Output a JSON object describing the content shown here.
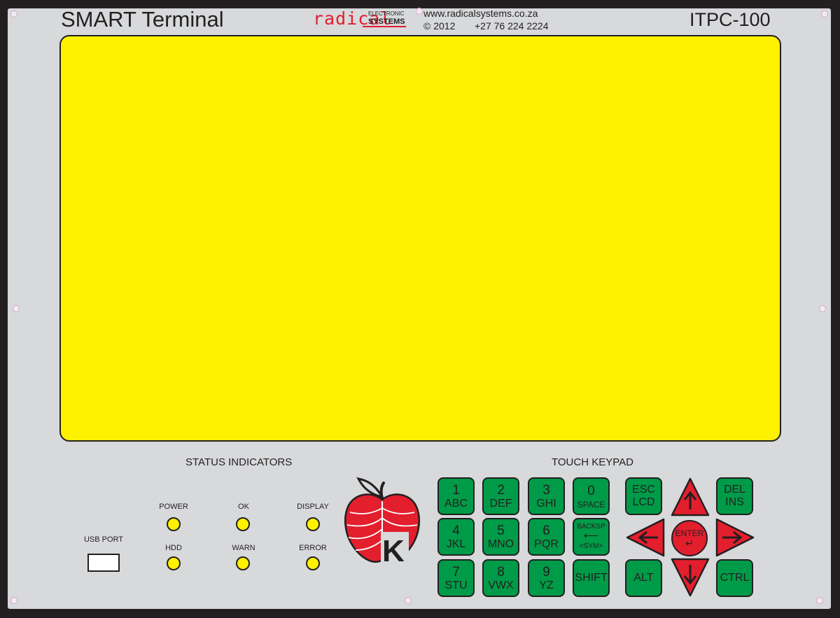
{
  "header": {
    "title": "SMART Terminal",
    "model": "ITPC-100",
    "logo": {
      "word": "radical",
      "sub1": "ELECTRONIC",
      "sub2": "SYSTEMS"
    },
    "website": "www.radicalsystems.co.za",
    "copyright": "© 2012",
    "phone": "+27 76 224 2224"
  },
  "status": {
    "heading": "STATUS INDICATORS",
    "leds": [
      {
        "label": "POWER",
        "color": "#fff200"
      },
      {
        "label": "OK",
        "color": "#fff200"
      },
      {
        "label": "DISPLAY",
        "color": "#fff200"
      },
      {
        "label": "HDD",
        "color": "#fff200"
      },
      {
        "label": "WARN",
        "color": "#fff200"
      },
      {
        "label": "ERROR",
        "color": "#fff200"
      }
    ]
  },
  "usb": {
    "label": "USB PORT"
  },
  "emblem": {
    "letter": "K"
  },
  "keypad": {
    "heading": "TOUCH KEYPAD",
    "keys": {
      "k1": {
        "num": "1",
        "letters": "ABC"
      },
      "k2": {
        "num": "2",
        "letters": "DEF"
      },
      "k3": {
        "num": "3",
        "letters": "GHI"
      },
      "k0": {
        "num": "0",
        "letters": "SPACE"
      },
      "k4": {
        "num": "4",
        "letters": "JKL"
      },
      "k5": {
        "num": "5",
        "letters": "MNO"
      },
      "k6": {
        "num": "6",
        "letters": "PQR"
      },
      "backsp": {
        "top": "BACKSP",
        "arrow": "⟵",
        "bottom": "<SYM>"
      },
      "k7": {
        "num": "7",
        "letters": "STU"
      },
      "k8": {
        "num": "8",
        "letters": "VWX"
      },
      "k9": {
        "num": "9",
        "letters": "YZ"
      },
      "shift": {
        "label": "SHIFT"
      },
      "esc": {
        "top": "ESC",
        "bottom": "LCD"
      },
      "alt": {
        "label": "ALT"
      },
      "del": {
        "top": "DEL",
        "bottom": "INS"
      },
      "ctrl": {
        "label": "CTRL"
      },
      "enter": {
        "label": "ENTER",
        "arrow": "↵"
      }
    }
  },
  "colors": {
    "lcd": "#fff200",
    "key_green": "#009b48",
    "arrow_red": "#e31e2d",
    "panel": "#d7d9db"
  }
}
